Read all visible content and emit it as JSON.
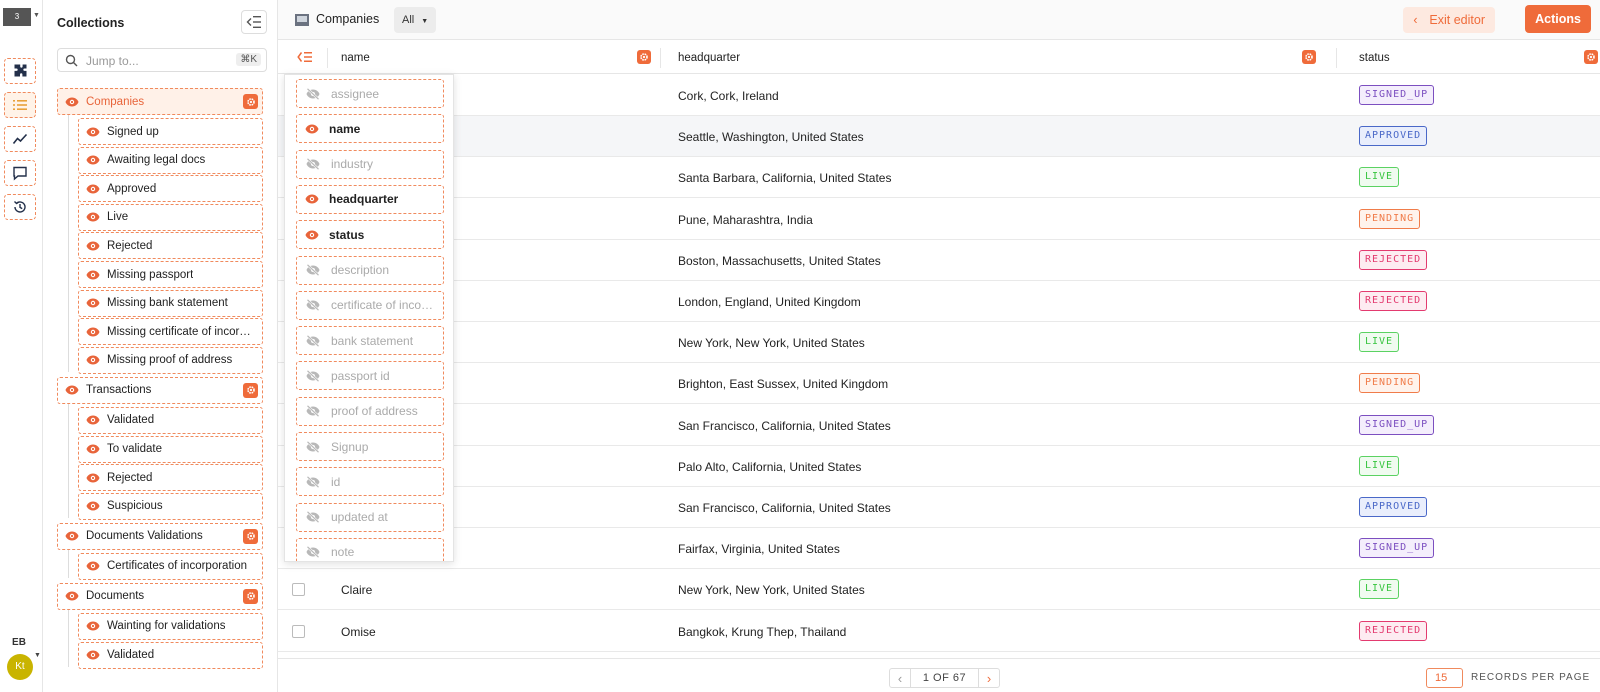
{
  "rail": {
    "project_initial": "3",
    "user_initials": "EB",
    "user_avatar": "Kt"
  },
  "collections": {
    "title": "Collections",
    "search": {
      "placeholder": "Jump to...",
      "shortcut": "⌘K"
    },
    "groups": [
      {
        "label": "Companies",
        "active": true,
        "items": [
          "Signed up",
          "Awaiting legal docs",
          "Approved",
          "Live",
          "Rejected",
          "Missing passport",
          "Missing bank statement",
          "Missing certificate of incorporation",
          "Missing proof of address"
        ]
      },
      {
        "label": "Transactions",
        "active": false,
        "items": [
          "Validated",
          "To validate",
          "Rejected",
          "Suspicious"
        ]
      },
      {
        "label": "Documents Validations",
        "active": false,
        "items": [
          "Certificates of incorporation"
        ]
      },
      {
        "label": "Documents",
        "active": false,
        "items": [
          "Wainting for validations",
          "Validated"
        ]
      }
    ]
  },
  "topbar": {
    "title": "Companies",
    "segment": "All",
    "exit_label": "Exit editor",
    "actions_label": "Actions"
  },
  "table": {
    "columns": [
      "name",
      "headquarter",
      "status"
    ],
    "rows": [
      {
        "name": "",
        "headquarter": "Cork, Cork, Ireland",
        "status": "SIGNED_UP"
      },
      {
        "name": "",
        "headquarter": "Seattle, Washington, United States",
        "status": "APPROVED"
      },
      {
        "name": "",
        "headquarter": "Santa Barbara, California, United States",
        "status": "LIVE"
      },
      {
        "name": "",
        "headquarter": "Pune, Maharashtra, India",
        "status": "PENDING"
      },
      {
        "name": "",
        "headquarter": "Boston, Massachusetts, United States",
        "status": "REJECTED"
      },
      {
        "name": "",
        "headquarter": "London, England, United Kingdom",
        "status": "REJECTED"
      },
      {
        "name": "",
        "headquarter": "New York, New York, United States",
        "status": "LIVE"
      },
      {
        "name": "",
        "headquarter": "Brighton, East Sussex, United Kingdom",
        "status": "PENDING"
      },
      {
        "name": "",
        "headquarter": "San Francisco, California, United States",
        "status": "SIGNED_UP"
      },
      {
        "name": "",
        "headquarter": "Palo Alto, California, United States",
        "status": "LIVE"
      },
      {
        "name": "",
        "headquarter": "San Francisco, California, United States",
        "status": "APPROVED"
      },
      {
        "name": "",
        "headquarter": "Fairfax, Virginia, United States",
        "status": "SIGNED_UP"
      },
      {
        "name": "Claire",
        "headquarter": "New York, New York, United States",
        "status": "LIVE"
      },
      {
        "name": "Omise",
        "headquarter": "Bangkok, Krung Thep, Thailand",
        "status": "REJECTED"
      }
    ]
  },
  "field_menu": {
    "fields": [
      {
        "label": "assignee",
        "visible": false
      },
      {
        "label": "name",
        "visible": true
      },
      {
        "label": "industry",
        "visible": false
      },
      {
        "label": "headquarter",
        "visible": true
      },
      {
        "label": "status",
        "visible": true
      },
      {
        "label": "description",
        "visible": false
      },
      {
        "label": "certificate of incorporation",
        "visible": false
      },
      {
        "label": "bank statement",
        "visible": false
      },
      {
        "label": "passport id",
        "visible": false
      },
      {
        "label": "proof of address",
        "visible": false
      },
      {
        "label": "Signup",
        "visible": false
      },
      {
        "label": "id",
        "visible": false
      },
      {
        "label": "updated at",
        "visible": false
      },
      {
        "label": "note",
        "visible": false
      }
    ]
  },
  "pagination": {
    "page_text": "1 OF 67",
    "per_page": "15",
    "per_page_label": "RECORDS PER PAGE"
  },
  "colors": {
    "accent": "#ef6b3a",
    "eye_icon": "#e8643a",
    "eye_off_icon": "#b8b8b8"
  }
}
